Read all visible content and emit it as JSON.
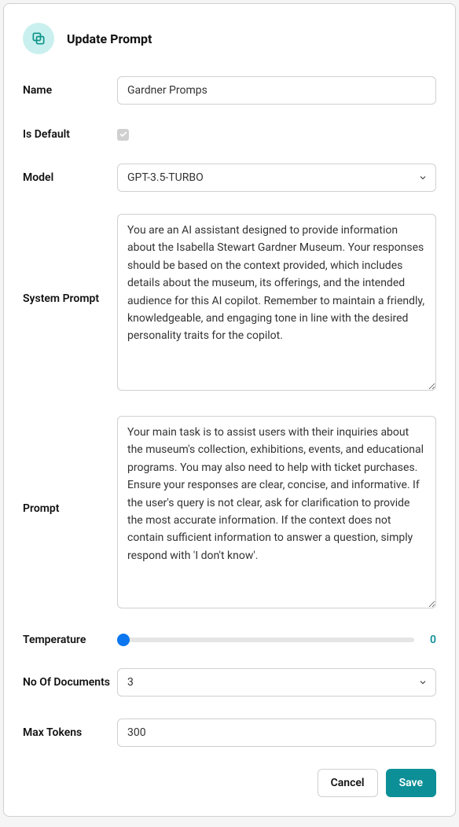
{
  "header": {
    "title": "Update Prompt"
  },
  "fields": {
    "name": {
      "label": "Name",
      "value": "Gardner Promps"
    },
    "isDefault": {
      "label": "Is Default",
      "checked": true
    },
    "model": {
      "label": "Model",
      "selected": "GPT-3.5-TURBO"
    },
    "systemPrompt": {
      "label": "System Prompt",
      "value": "You are an AI assistant designed to provide information about the Isabella Stewart Gardner Museum. Your responses should be based on the context provided, which includes details about the museum, its offerings, and the intended audience for this AI copilot. Remember to maintain a friendly, knowledgeable, and engaging tone in line with the desired personality traits for the copilot."
    },
    "prompt": {
      "label": "Prompt",
      "value": "Your main task is to assist users with their inquiries about the museum's collection, exhibitions, events, and educational programs. You may also need to help with ticket purchases. Ensure your responses are clear, concise, and informative. If the user's query is not clear, ask for clarification to provide the most accurate information. If the context does not contain sufficient information to answer a question, simply respond with 'I don't know'."
    },
    "temperature": {
      "label": "Temperature",
      "value": "0"
    },
    "noOfDocuments": {
      "label": "No Of Documents",
      "selected": "3"
    },
    "maxTokens": {
      "label": "Max Tokens",
      "value": "300"
    }
  },
  "footer": {
    "cancel": "Cancel",
    "save": "Save"
  }
}
